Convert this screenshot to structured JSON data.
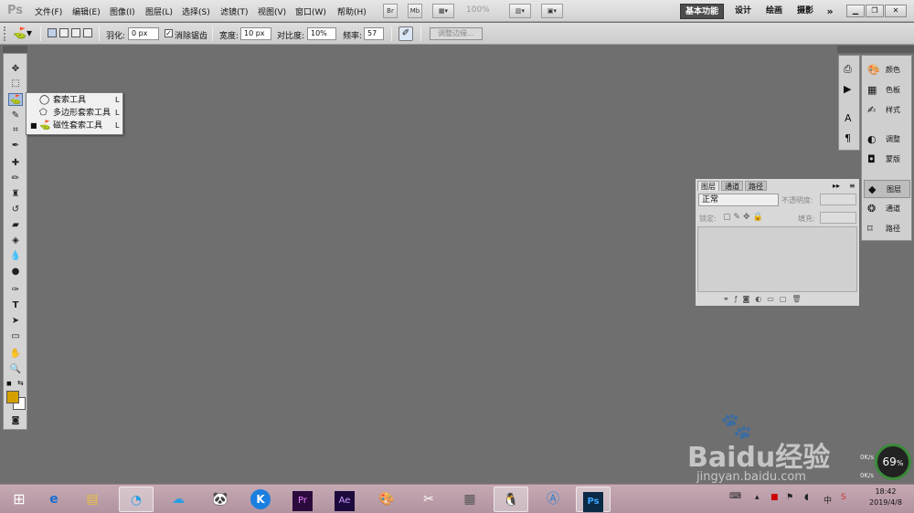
{
  "app": {
    "logo": "Ps"
  },
  "menu": [
    "文件(F)",
    "编辑(E)",
    "图像(I)",
    "图层(L)",
    "选择(S)",
    "滤镜(T)",
    "视图(V)",
    "窗口(W)",
    "帮助(H)"
  ],
  "menubar_buttons": {
    "br": "Br",
    "mb": "Mb",
    "zoom": "100%"
  },
  "workspaces": [
    "基本功能",
    "设计",
    "绘画",
    "摄影"
  ],
  "workspace_more": "»",
  "options": {
    "feather_label": "羽化:",
    "feather_value": "0 px",
    "antialias_label": "消除锯齿",
    "width_label": "宽度:",
    "width_value": "10 px",
    "contrast_label": "对比度:",
    "contrast_value": "10%",
    "frequency_label": "频率:",
    "frequency_value": "57",
    "refine_edge": "调整边缘..."
  },
  "flyout": [
    {
      "label": "套索工具",
      "key": "L",
      "active": false
    },
    {
      "label": "多边形套索工具",
      "key": "L",
      "active": false
    },
    {
      "label": "磁性套索工具",
      "key": "L",
      "active": true
    }
  ],
  "right_panel": [
    "颜色",
    "色板",
    "样式",
    "调整",
    "蒙版",
    "图层",
    "通道",
    "路径"
  ],
  "layers_panel": {
    "tabs": [
      "图层",
      "通道",
      "路径"
    ],
    "blend_mode": "正常",
    "opacity_label": "不透明度:",
    "lock_label": "锁定:",
    "fill_label": "填充:"
  },
  "colors": {
    "foreground": "#d4a000",
    "background": "#ffffff"
  },
  "taskbar": {
    "apps": [
      "ie-icon",
      "explorer-icon",
      "browser-icon",
      "baidu-netdisk-icon",
      "panda-icon",
      "kugou-icon",
      "premiere-icon",
      "after-effects-icon",
      "paint-icon",
      "tool-icon",
      "calculator-icon",
      "qq-icon",
      "arc-icon",
      "photoshop-icon"
    ],
    "premiere_label": "Pr",
    "ae_label": "Ae",
    "ps_label": "Ps",
    "ime": "中",
    "time": "18:42",
    "date": "2019/4/8"
  },
  "gauge": {
    "value": "69",
    "unit": "%",
    "net_up": "0K/s",
    "net_down": "0K/s"
  },
  "watermark": {
    "brand": "Baidu经验",
    "url": "jingyan.baidu.com"
  }
}
